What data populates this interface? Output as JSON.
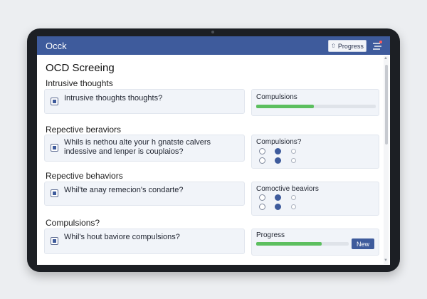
{
  "app": {
    "title": "Occk"
  },
  "header": {
    "progress_label": "Progress",
    "progress_icon": "arrow-icon",
    "menu_icon": "menu-icon"
  },
  "page": {
    "title": "OCD Screeing"
  },
  "sections": [
    {
      "label": "Intrusive thoughts",
      "question": "Intrusive thoughts thoughts?"
    },
    {
      "label": "Repective beraviors",
      "question": "Whils is nethou alte your h gnatste calvers\nindessive and lenper is couplaios?"
    },
    {
      "label": "Repective behaviors",
      "question": "Whil'te anay remecion's condarte?"
    },
    {
      "label": "Compulsions?",
      "question": "Whil's hout baviore compulsions?"
    }
  ],
  "side_panels": [
    {
      "title": "Compulsions",
      "progress": 0.48
    },
    {
      "title": "Compulsions?",
      "radio_rows": [
        [
          false,
          true,
          false
        ],
        [
          false,
          true,
          false
        ]
      ]
    },
    {
      "title": "Comoctive beaviors",
      "radio_rows": [
        [
          false,
          true,
          false
        ],
        [
          false,
          true,
          false
        ]
      ]
    },
    {
      "title": "Progress",
      "progress": 0.71,
      "button": "New"
    }
  ],
  "colors": {
    "header_bg": "#3e5b9c",
    "progress_green": "#5cbf5f",
    "accent": "#3e5b9c"
  }
}
